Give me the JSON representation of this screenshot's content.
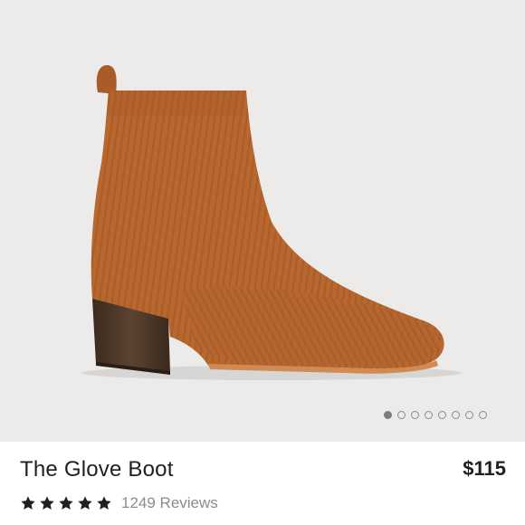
{
  "product": {
    "title": "The Glove Boot",
    "price": "$115",
    "rating": 5,
    "rating_max": 5,
    "reviews_label": "1249 Reviews"
  },
  "gallery": {
    "image_count": 8,
    "active_index": 0,
    "image_icon": "ankle-boot"
  },
  "colors": {
    "background": "#ecebe9",
    "boot": "#b8682f",
    "heel": "#4a3526",
    "text": "#1f1f1f",
    "muted": "#8c8c8c"
  }
}
